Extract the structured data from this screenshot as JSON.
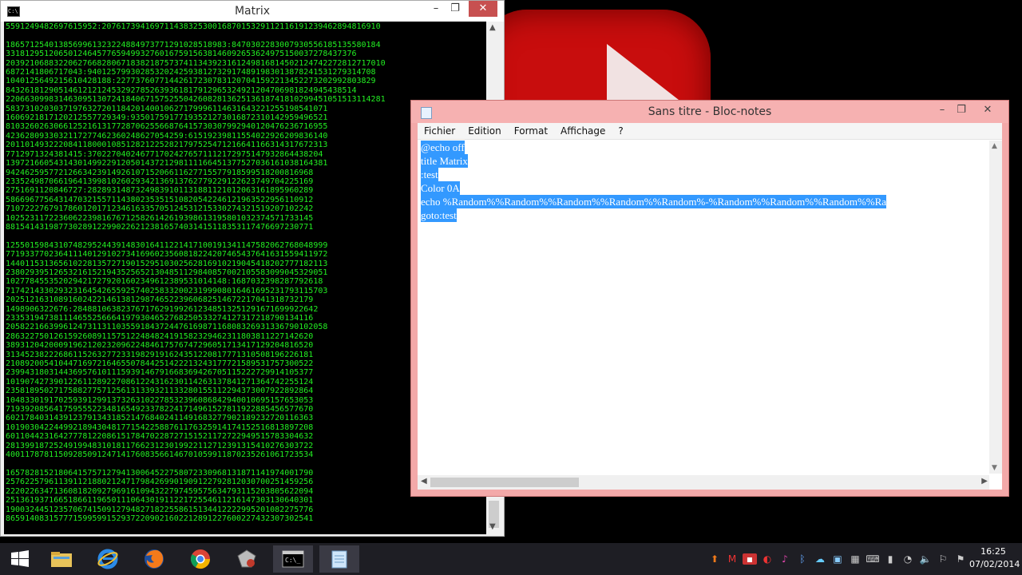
{
  "cmd": {
    "title": "Matrix",
    "minimize": "–",
    "maximize": "❐",
    "close": "✕",
    "icon_label": "C:\\",
    "output_lines": [
      "5591249482697615952:2076173941697114383253001687015329112116191239462894816910",
      "",
      "1865712540138569961323224884973771291028518983:8470302283007930556185135580184",
      "3318129512065012464577659499327601675915638146092653624975150037278437376",
      "2039210688322062766828067183821875737411343923161249816814502124742272812717010",
      "6872141806717043:940125799302853202425938127329174891983013878241531279314708",
      "1040125649215610428188:227737607714426172307831207041592213452273202992803829",
      "8432618129051461212124532927852639361817912965324921204706981824945438514",
      "2206630998314630951307241840671575255042608281362513618741810299451051513114281",
      "5837310203037197632720118420140010627179996114631643221255198541071",
      "1606921817120212557729349:93501759177193521273016872310142959496521",
      "8103260263066125216131772870625566876415730307992940120476236716955",
      "4236280933032117277462360248627054259:61519239811554022926209836140",
      "2011014932220841180001085128212252821797525471216641166314317672313",
      "7712971324381415:3702270402467717024276571112172975147932864438204",
      "1397216605431430149922912050143721298111166451377527036161038164381",
      "9424625957721266342391492610715206611627715577918599518200816968",
      "2335249870661964139981026029342136913762779229122623749704225169",
      "2751691120846727:28289314873249839101131881121012063161895960289",
      "5866967756431470321557114380235351510820542246121963522956110912",
      "7107222767917860120171234616335705124531215330274321519207102242",
      "1025231172236062239816767125826142619398613195801032374571733145",
      "8815414319877302891229902262123816574031415118353117476697230771",
      "",
      "1255015984310748295244391483016411221417100191341147582062768048999",
      "7719337702364111401291027341696023560818224207465437641631559411972",
      "1440115313656102281357271901529510302562816910219045418202777182113",
      "2380293951265321615219435256521304851129840857002105583099045329051",
      "1027784553520294217279201602349612389531014148:1687032398287792618",
      "7174214330293231645426559257402583320023199908016461695231793115703",
      "2025121631089160242214613812987465223960682514672217041318732179",
      "1498906322676:284881063823767176291992612348513251291671699922642",
      "2335319473811146552566641979304652768250533274127317218790134116",
      "2058221663996124731131103559184372447616987116808326931336790102058",
      "2863227501261592608911575122484824191582329462311803811227142620",
      "3893120420009196212023209622484617576747296051713417129204816520",
      "3134523822268611526327723319829191624351220817771310508196226181",
      "2108920054104471697216465507844251422213243177721589531757300522",
      "2399431803144369576101115939146791668369426705115222729914105377",
      "1019074273901226112892270861224316230114263137841271364742255124",
      "2358189502717588277571256131339321133280155112294373007922892864",
      "1048330191702593912991373263102278532396086842940010695157653053",
      "7193920856417595552234816549233782241714961527811922885456577670",
      "6021784031439123791343185214768402411491683277902189232720116363",
      "1019030422449921894304817715422588761176325914174152516813897208",
      "6011044231642777812208615178470228727151521172722949515783304632",
      "2813991872524919948310181176623123019922112712391315410276303722",
      "4001178781150928509124714176083566146701059911870235261061723534",
      "",
      "1657828152180641575712794130064522758072330968131871141974001790",
      "2576225796113911218802124717984269901909122792812030700251459256",
      "2220226347136081820927969161094322797459575634793115203805622094",
      "2513619371665186611965011106430191122172554611216147303130640301",
      "1900324451235706741509127948271822558615134412222995201082275776",
      "8659140831577715995991529372209021602212891227600227432307302541"
    ]
  },
  "notepad": {
    "title": "Sans titre - Bloc-notes",
    "minimize": "–",
    "maximize": "❐",
    "close": "✕",
    "menu": [
      "Fichier",
      "Edition",
      "Format",
      "Affichage",
      "?"
    ],
    "lines": [
      "@echo off",
      "title Matrix",
      ":test",
      "Color 0A",
      "echo %Random%%Random%%Random%%Random%%Random%-%Random%%Random%%Random%%Ra",
      "goto:test"
    ]
  },
  "taskbar": {
    "time": "16:25",
    "date": "07/02/2014",
    "apps": [
      "start",
      "file-explorer",
      "internet-explorer",
      "firefox",
      "chrome",
      "tool",
      "cmd",
      "notepad"
    ]
  },
  "colors": {
    "matrix_green": "#22ee22",
    "selection": "#3399ff",
    "notepad_frame": "#f3a9a9",
    "taskbar": "#1e1e24"
  }
}
